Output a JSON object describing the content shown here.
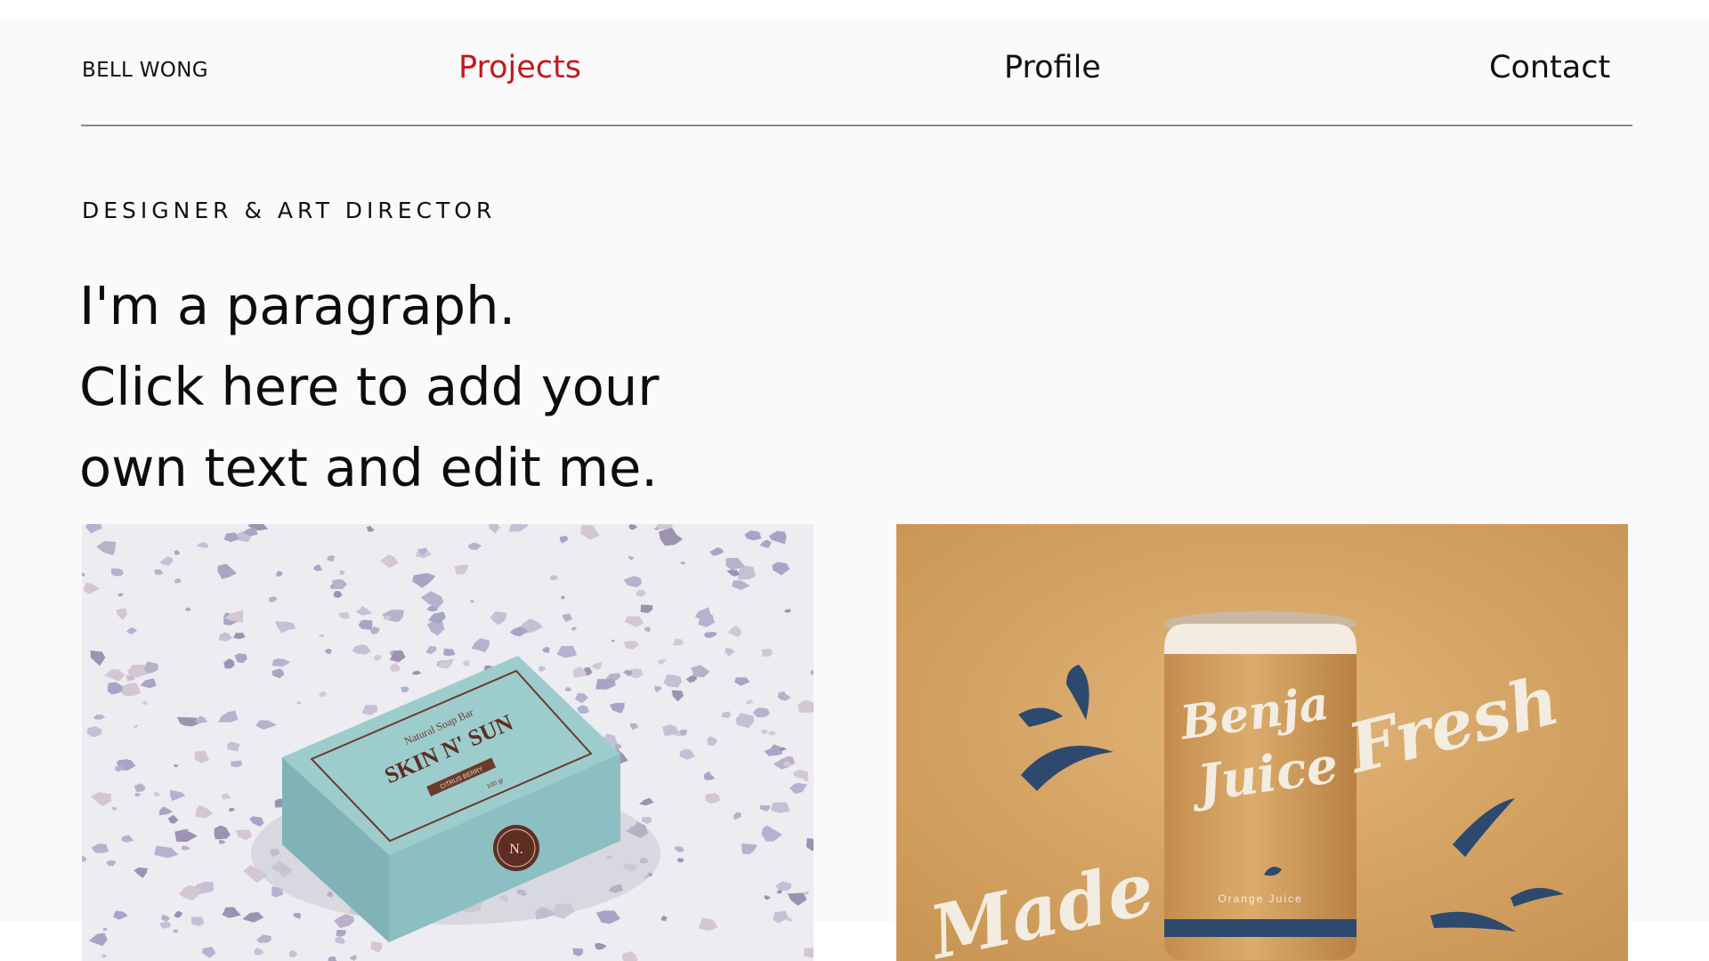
{
  "header": {
    "logo": "BELL WONG",
    "nav": [
      {
        "label": "Projects",
        "active": true
      },
      {
        "label": "Profile",
        "active": false
      },
      {
        "label": "Contact",
        "active": false
      }
    ]
  },
  "hero": {
    "role": "DESIGNER & ART DIRECTOR",
    "paragraph_lines": [
      "I'm a paragraph.",
      "Click here to add your",
      "own text and edit me."
    ]
  },
  "projects": [
    {
      "box_subtitle": "Natural Soap Bar",
      "box_title": "SKIN N' SUN",
      "box_tag": "CITRUS BERRY",
      "box_weight": "100 gr",
      "box_seal": "N."
    },
    {
      "can_brand_line1": "Benja",
      "can_brand_line2": "Juice",
      "can_flavor": "Orange Juice",
      "word_fresh": "Fresh",
      "word_made": "Made"
    }
  ],
  "colors": {
    "accent": "#c8161d",
    "text": "#111111",
    "panel_bg": "#fafafa",
    "divider": "#8a8a8a",
    "soap_box": "#97c6c7",
    "juice_bg": "#d6a566",
    "juice_accent": "#2d4a6e"
  }
}
